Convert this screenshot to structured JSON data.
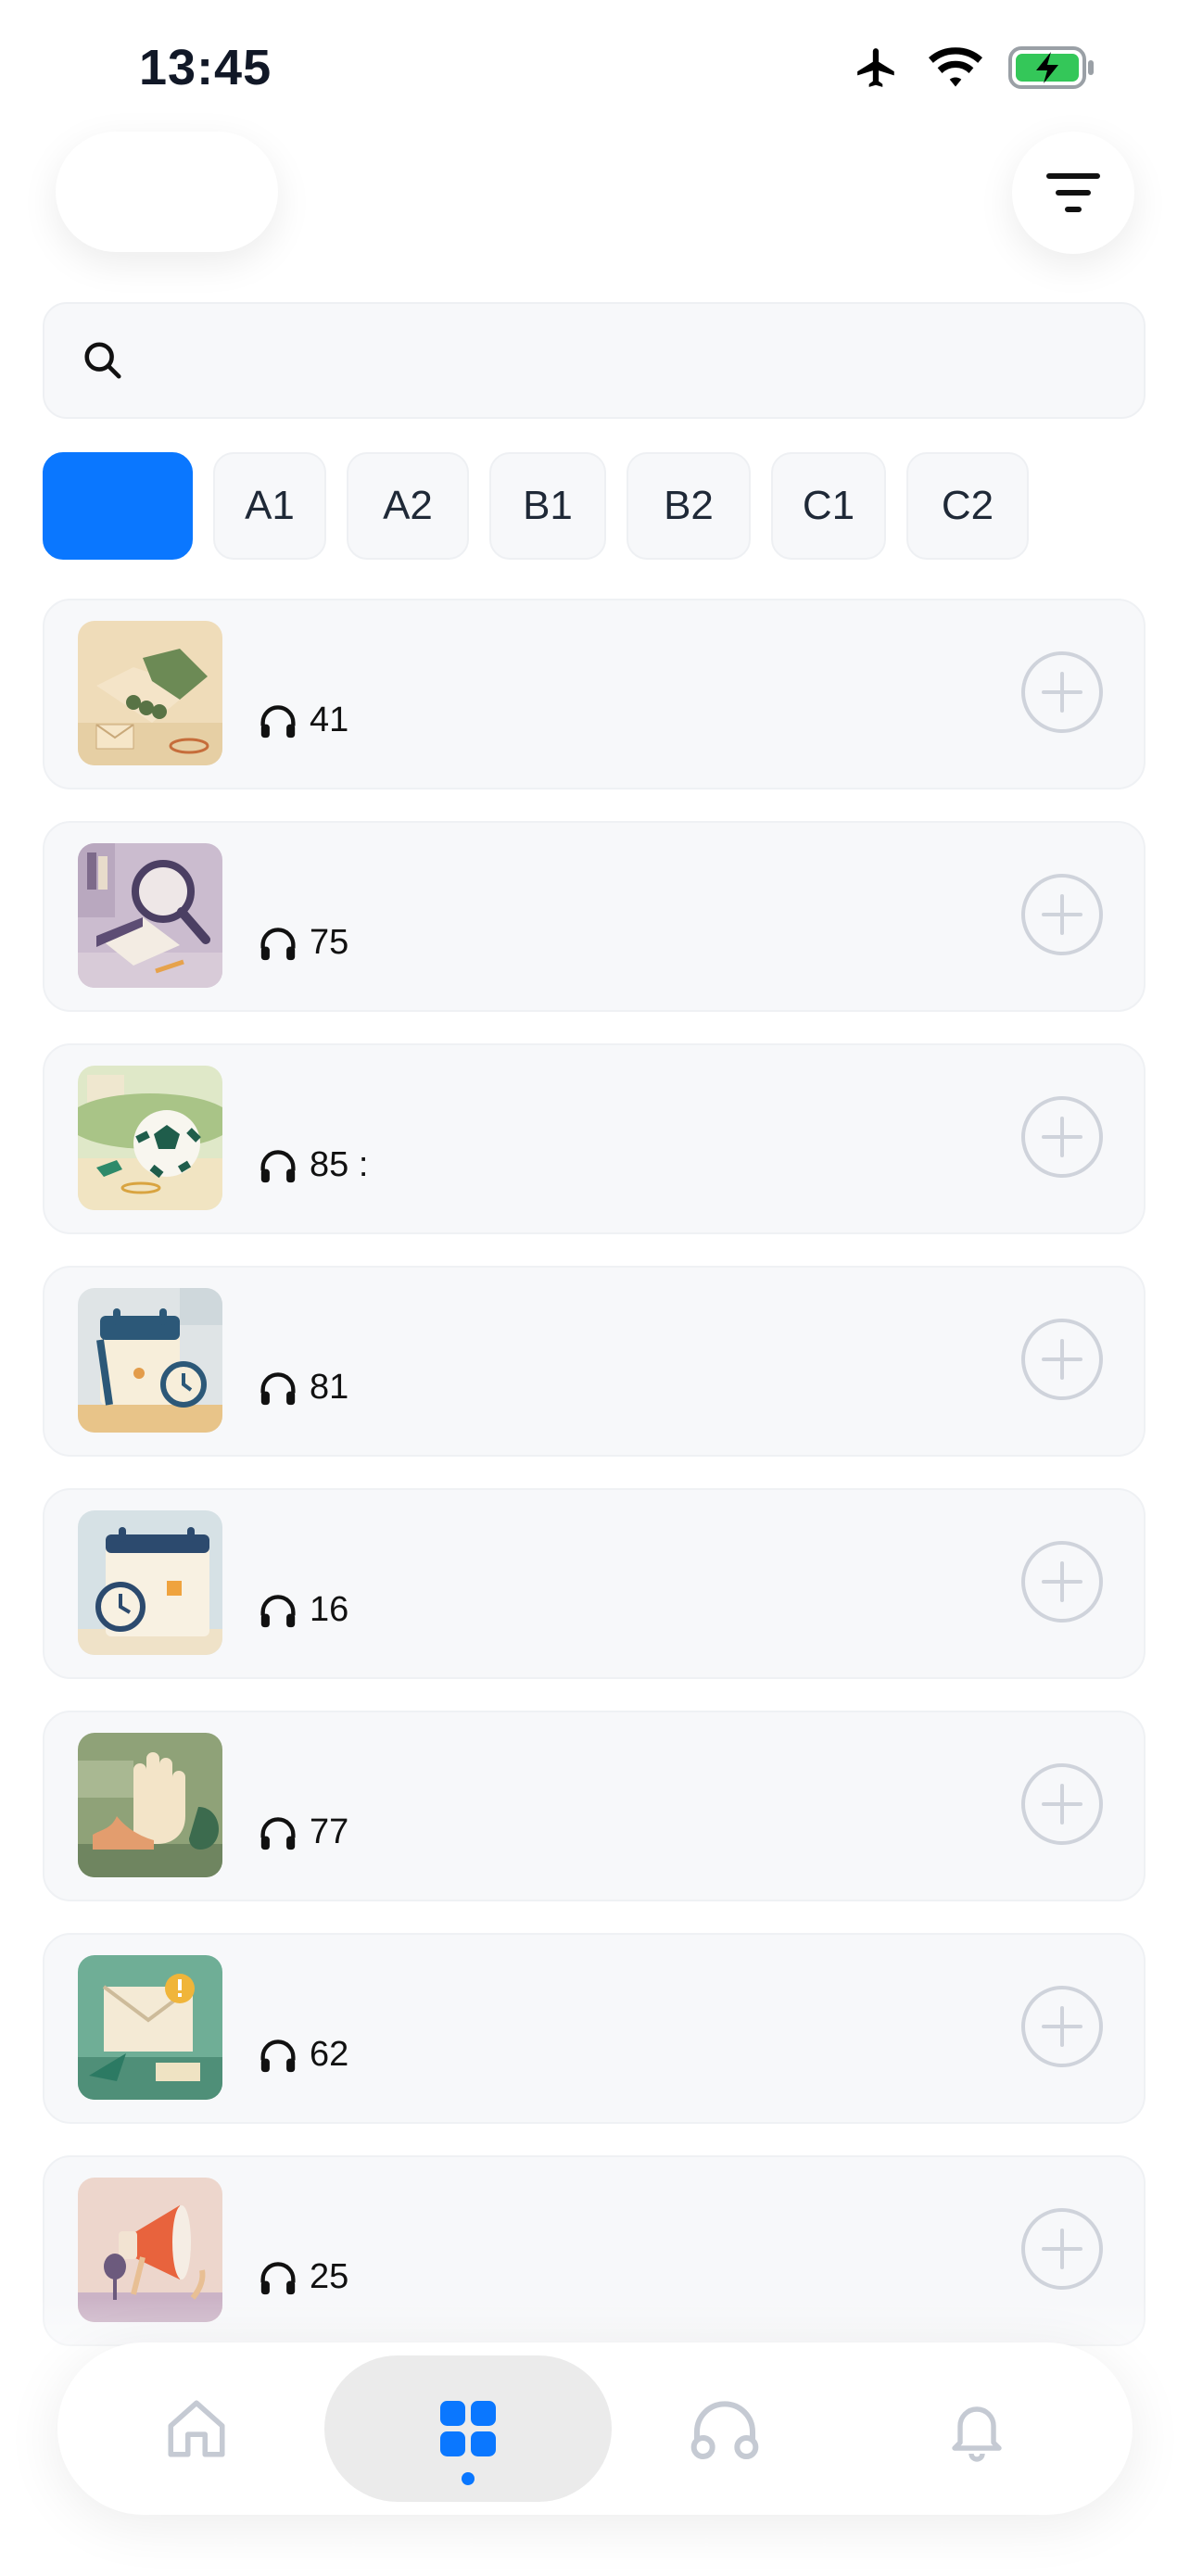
{
  "status_bar": {
    "time": "13:45"
  },
  "search": {
    "placeholder": ""
  },
  "levels": [
    {
      "label": "",
      "active": true
    },
    {
      "label": "A1",
      "active": false
    },
    {
      "label": "A2",
      "active": false
    },
    {
      "label": "B1",
      "active": false
    },
    {
      "label": "B2",
      "active": false
    },
    {
      "label": "C1",
      "active": false
    },
    {
      "label": "C2",
      "active": false
    }
  ],
  "lessons": [
    {
      "listens": "41",
      "image": "handshake-scene"
    },
    {
      "listens": "75",
      "image": "magnifier-book-scene"
    },
    {
      "listens": "85 :",
      "image": "soccer-ball-scene"
    },
    {
      "listens": "81",
      "image": "calendar-alarm-clock-scene"
    },
    {
      "listens": "16",
      "image": "calendar-clock-scene"
    },
    {
      "listens": "77",
      "image": "hand-foot-ear-scene"
    },
    {
      "listens": "62",
      "image": "envelope-paper-plane-scene"
    },
    {
      "listens": "25",
      "image": "megaphone-microphone-scene"
    }
  ],
  "tab_bar": {
    "tabs": [
      {
        "icon": "home-icon",
        "active": false
      },
      {
        "icon": "grid-icon",
        "active": true
      },
      {
        "icon": "headphones-icon",
        "active": false
      },
      {
        "icon": "bell-icon",
        "active": false
      }
    ]
  },
  "colors": {
    "accent": "#0a77ff",
    "card_bg": "#f7f8fa",
    "icon_gray": "#c9cdd6"
  }
}
